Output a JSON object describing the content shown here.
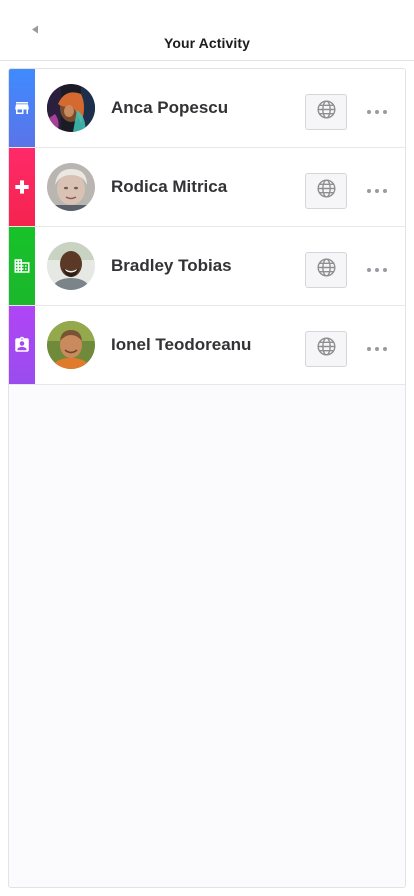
{
  "header": {
    "title": "Your Activity",
    "back_icon": "back-arrow-icon"
  },
  "contacts": [
    {
      "name": "Anca Popescu",
      "category_icon": "store-icon",
      "category_color": "#4a86f0",
      "action_icon": "globe-icon",
      "menu_icon": "more-horizontal-icon"
    },
    {
      "name": "Rodica Mitrica",
      "category_icon": "medical-cross-icon",
      "category_color": "#f5234e",
      "action_icon": "globe-icon",
      "menu_icon": "more-horizontal-icon"
    },
    {
      "name": "Bradley Tobias",
      "category_icon": "office-building-icon",
      "category_color": "#1bbf2a",
      "action_icon": "globe-icon",
      "menu_icon": "more-horizontal-icon"
    },
    {
      "name": "Ionel Teodoreanu",
      "category_icon": "contact-badge-icon",
      "category_color": "#a24ef0",
      "action_icon": "globe-icon",
      "menu_icon": "more-horizontal-icon"
    }
  ]
}
